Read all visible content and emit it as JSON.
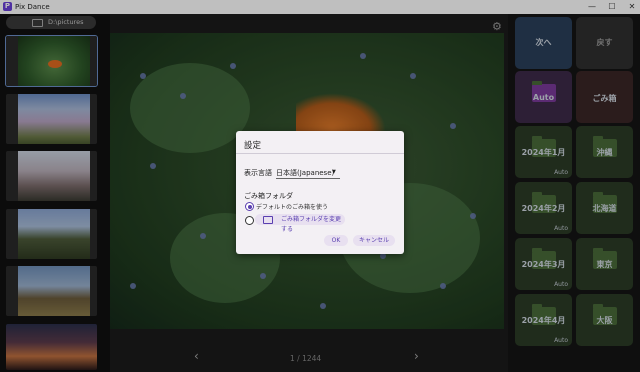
{
  "window": {
    "title": "Pix Dance",
    "app_icon": "P",
    "minimize": "—",
    "maximize": "☐",
    "close": "✕"
  },
  "sidebar": {
    "folder_path": "D:\\pictures",
    "thumbnails": [
      "clownfish",
      "flowering-tree",
      "cherry-tree",
      "mountain",
      "rock-field",
      "night-street"
    ]
  },
  "viewer": {
    "counter": "1 / 1244",
    "prev": "‹",
    "next": "›"
  },
  "actions": {
    "next_label": "次へ",
    "back_label": "戻す",
    "auto_label": "Auto",
    "trash_label": "ごみ箱"
  },
  "folders": [
    {
      "label": "2024年1月",
      "sub": "Auto"
    },
    {
      "label": "沖縄",
      "sub": ""
    },
    {
      "label": "2024年2月",
      "sub": "Auto"
    },
    {
      "label": "北海道",
      "sub": ""
    },
    {
      "label": "2024年3月",
      "sub": "Auto"
    },
    {
      "label": "東京",
      "sub": ""
    },
    {
      "label": "2024年4月",
      "sub": "Auto"
    },
    {
      "label": "大阪",
      "sub": ""
    }
  ],
  "dialog": {
    "title": "設定",
    "language_label": "表示言語",
    "language_value": "日本語(Japanese)",
    "trash_folder_label": "ごみ箱フォルダ",
    "option_default": "デフォルトのごみ箱を使う",
    "change_folder_button": "ごみ箱フォルダを変更する",
    "ok": "OK",
    "cancel": "キャンセル"
  },
  "colors": {
    "accent": "#5a3fb0",
    "next_tile": "#2a3f5a",
    "folder_tile": "#2b3b26",
    "trash_tile": "#3a2626"
  }
}
